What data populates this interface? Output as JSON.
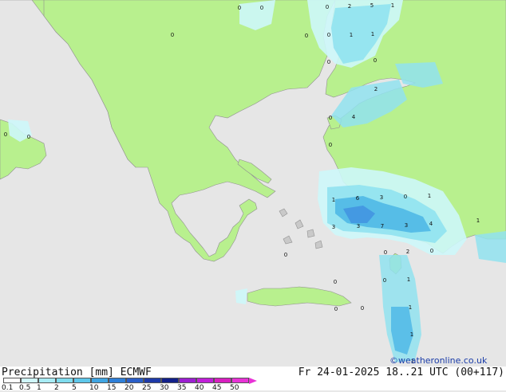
{
  "colors": {
    "sea": "#e6e6e6",
    "land": "#b8f08e",
    "border": "#909090",
    "precip_light": "#cdf7fa",
    "precip_mid": "#90e2ef",
    "precip_strong": "#4fb8e6",
    "precip_heavy": "#3f8de0"
  },
  "map": {
    "copyright": "©weatheronline.co.uk",
    "values": [
      {
        "text": "0"
      },
      {
        "text": "0"
      },
      {
        "text": "0"
      },
      {
        "text": "2"
      },
      {
        "text": "5"
      },
      {
        "text": "1"
      },
      {
        "text": "0"
      },
      {
        "text": "0"
      },
      {
        "text": "0"
      },
      {
        "text": "1"
      },
      {
        "text": "1"
      },
      {
        "text": "0"
      },
      {
        "text": "0"
      },
      {
        "text": "2"
      },
      {
        "text": "0"
      },
      {
        "text": "4"
      },
      {
        "text": "0"
      },
      {
        "text": "0"
      },
      {
        "text": "0"
      },
      {
        "text": "1"
      },
      {
        "text": "6"
      },
      {
        "text": "3"
      },
      {
        "text": "0"
      },
      {
        "text": "1"
      },
      {
        "text": "3"
      },
      {
        "text": "3"
      },
      {
        "text": "7"
      },
      {
        "text": "3"
      },
      {
        "text": "4"
      },
      {
        "text": "1"
      },
      {
        "text": "0"
      },
      {
        "text": "0"
      },
      {
        "text": "2"
      },
      {
        "text": "0"
      },
      {
        "text": "0"
      },
      {
        "text": "0"
      },
      {
        "text": "1"
      },
      {
        "text": "0"
      },
      {
        "text": "0"
      },
      {
        "text": "1"
      },
      {
        "text": "1"
      },
      {
        "text": "1"
      }
    ]
  },
  "footer": {
    "title": "Precipitation [mm] ECMWF",
    "datetime": "Fr 24-01-2025 18..21 UTC (00+117)"
  },
  "legend": {
    "labels": [
      "0.1",
      "0.5",
      "1",
      "2",
      "5",
      "10",
      "15",
      "20",
      "25",
      "30",
      "35",
      "40",
      "45",
      "50"
    ],
    "colors": [
      "#fefefe",
      "#d0f6fb",
      "#a8ecf5",
      "#7fdcee",
      "#5ec7ea",
      "#3fa5e3",
      "#2e7fd8",
      "#2a5ec8",
      "#1e3aa8",
      "#12208a",
      "#9b1fd0",
      "#c01fd8",
      "#d81fc0",
      "#e832d6"
    ]
  }
}
